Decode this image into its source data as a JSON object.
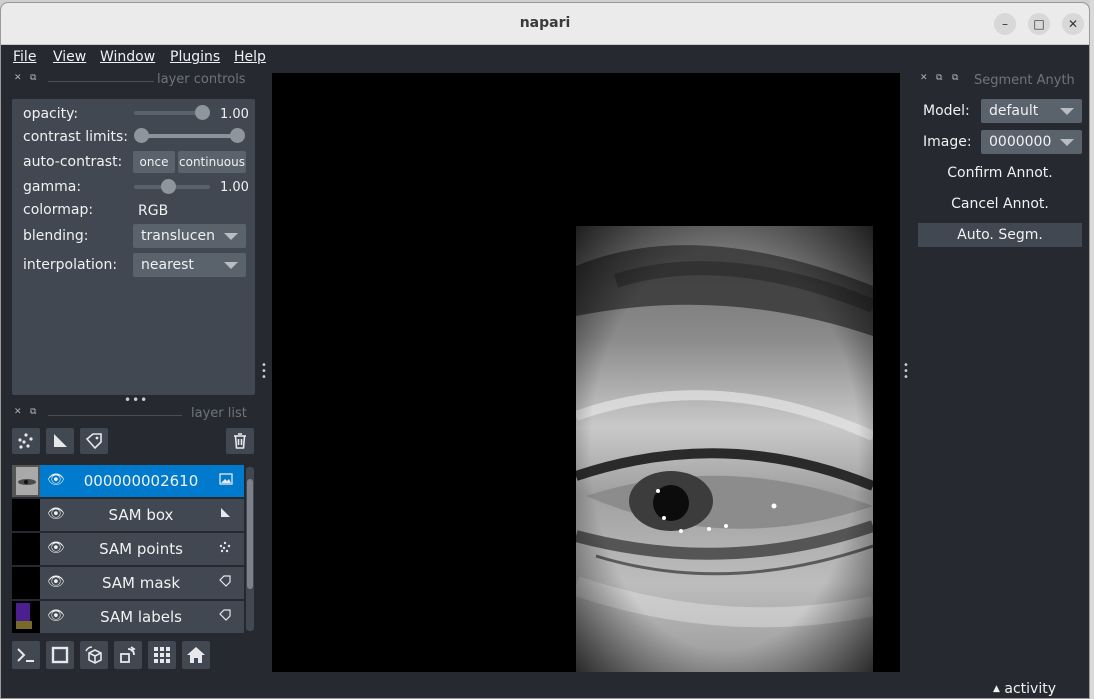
{
  "window": {
    "title": "napari",
    "minimize": "–",
    "maximize": "□",
    "close": "✕"
  },
  "menu": [
    {
      "label": "File"
    },
    {
      "label": "View"
    },
    {
      "label": "Window"
    },
    {
      "label": "Plugins"
    },
    {
      "label": "Help"
    }
  ],
  "layer_controls": {
    "header": "layer controls",
    "opacity": {
      "label": "opacity:",
      "value": "1.00",
      "level": 1.0
    },
    "contrast_limits": {
      "label": "contrast limits:"
    },
    "auto_contrast": {
      "label": "auto-contrast:",
      "once": "once",
      "continuous": "continuous"
    },
    "gamma": {
      "label": "gamma:",
      "value": "1.00"
    },
    "colormap": {
      "label": "colormap:",
      "value": "RGB"
    },
    "blending": {
      "label": "blending:",
      "value": "translucen"
    },
    "interpolation": {
      "label": "interpolation:",
      "value": "nearest"
    }
  },
  "layer_list": {
    "header": "layer list",
    "layers": [
      {
        "name": "000000002610",
        "type_icon": "image-icon",
        "selected": true
      },
      {
        "name": "SAM box",
        "type_icon": "shape-icon",
        "selected": false
      },
      {
        "name": "SAM points",
        "type_icon": "points-icon",
        "selected": false
      },
      {
        "name": "SAM mask",
        "type_icon": "label-icon",
        "selected": false
      },
      {
        "name": "SAM labels",
        "type_icon": "label-icon",
        "selected": false
      }
    ]
  },
  "segment_panel": {
    "header": "Segment Anyth",
    "model_label": "Model:",
    "model_value": "default",
    "image_label": "Image:",
    "image_value": "0000000",
    "confirm": "Confirm Annot.",
    "cancel": "Cancel Annot.",
    "auto": "Auto. Segm."
  },
  "status": {
    "activity": "activity"
  },
  "colors": {
    "bg": "#262930",
    "panel": "#414851",
    "selected": "#007acc"
  }
}
